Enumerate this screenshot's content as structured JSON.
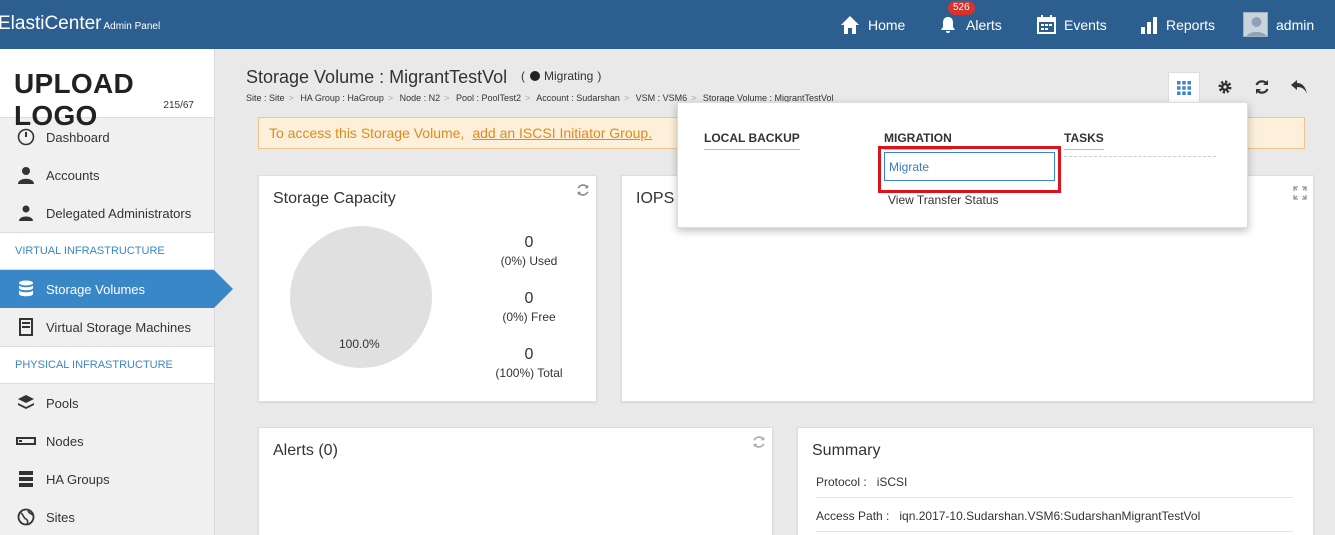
{
  "brand": {
    "name": "ElastiCenter",
    "sub": "Admin Panel"
  },
  "topnav": {
    "home": "Home",
    "alerts": "Alerts",
    "alerts_count": "526",
    "events": "Events",
    "reports": "Reports",
    "user": "admin"
  },
  "sidebar": {
    "logo": "UPLOAD LOGO",
    "logo_dim": "215/67",
    "items": [
      {
        "label": "Dashboard",
        "icon": "dashboard-icon"
      },
      {
        "label": "Accounts",
        "icon": "user-icon"
      },
      {
        "label": "Delegated Administrators",
        "icon": "admin-user-icon"
      }
    ],
    "section_virtual": "VIRTUAL INFRASTRUCTURE",
    "virtual_items": [
      {
        "label": "Storage Volumes",
        "icon": "database-icon",
        "active": true
      },
      {
        "label": "Virtual Storage Machines",
        "icon": "server-icon"
      }
    ],
    "section_physical": "PHYSICAL INFRASTRUCTURE",
    "physical_items": [
      {
        "label": "Pools",
        "icon": "layers-icon"
      },
      {
        "label": "Nodes",
        "icon": "node-icon"
      },
      {
        "label": "HA Groups",
        "icon": "ha-group-icon"
      },
      {
        "label": "Sites",
        "icon": "globe-icon"
      }
    ]
  },
  "header": {
    "title": "Storage Volume : MigrantTestVol",
    "status_open": "(",
    "status": "Migrating",
    "status_close": ")",
    "breadcrumbs": [
      "Site : Site",
      "HA Group : HaGroup",
      "Node : N2",
      "Pool : PoolTest2",
      "Account : Sudarshan",
      "VSM : VSM6",
      "Storage Volume : MigrantTestVol"
    ]
  },
  "warning": {
    "text": "To access this Storage Volume,",
    "link": "add an ISCSI Initiator Group."
  },
  "storage_capacity": {
    "title": "Storage Capacity",
    "pie_label": "100.0%",
    "used_value": "0",
    "used_label": "(0%) Used",
    "free_value": "0",
    "free_label": "(0%) Free",
    "total_value": "0",
    "total_label": "(100%) Total"
  },
  "iops": {
    "title": "IOPS"
  },
  "alerts_panel": {
    "title": "Alerts (0)"
  },
  "summary": {
    "title": "Summary",
    "protocol_key": "Protocol :",
    "protocol_value": "iSCSI",
    "access_key": "Access Path :",
    "access_value": "iqn.2017-10.Sudarshan.VSM6:SudarshanMigrantTestVol"
  },
  "dropdown": {
    "local_backup": "LOCAL BACKUP",
    "migration": "MIGRATION",
    "tasks": "TASKS",
    "migrate": "Migrate",
    "view_transfer": "View Transfer Status"
  },
  "colors": {
    "topbar": "#2c5f90",
    "accent": "#3a87c8",
    "warning_text": "#e08a1e",
    "highlight": "#d9141c"
  }
}
